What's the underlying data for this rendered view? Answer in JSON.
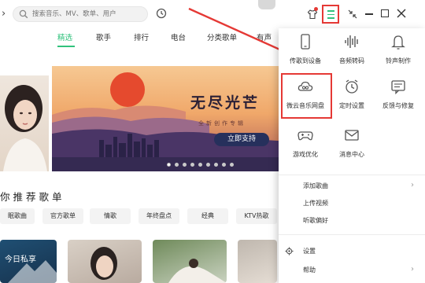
{
  "search": {
    "placeholder": "搜索音乐、MV、歌单、用户"
  },
  "nav": {
    "tabs": [
      {
        "label": "精选",
        "active": true
      },
      {
        "label": "歌手"
      },
      {
        "label": "排行"
      },
      {
        "label": "电台"
      },
      {
        "label": "分类歌单"
      },
      {
        "label": "有声"
      }
    ]
  },
  "banner": {
    "title": "无尽光芒",
    "subtitle": "全新创作专辑",
    "cta": "立即支持",
    "slides_total": 9,
    "slide_active": 1
  },
  "recommend": {
    "title": "你推荐歌单",
    "chips": [
      "眠歌曲",
      "官方歌单",
      "情歌",
      "年终盘点",
      "经典",
      "KTV热歌"
    ],
    "cards": [
      {
        "label": "今日私享"
      }
    ]
  },
  "menu_panel": {
    "grid": [
      {
        "label": "传歌到设备",
        "icon": "phone-icon"
      },
      {
        "label": "音频转码",
        "icon": "audio-wave-icon"
      },
      {
        "label": "铃声制作",
        "icon": "bell-icon"
      },
      {
        "label": "微云音乐网盘",
        "icon": "cloud-icon",
        "highlighted": true
      },
      {
        "label": "定时设置",
        "icon": "alarm-clock-icon"
      },
      {
        "label": "反馈与修复",
        "icon": "feedback-icon"
      },
      {
        "label": "游戏优化",
        "icon": "gamepad-icon"
      },
      {
        "label": "消息中心",
        "icon": "mail-icon"
      }
    ],
    "list": [
      {
        "label": "添加歌曲",
        "has_submenu": true
      },
      {
        "label": "上传视频",
        "has_submenu": false
      },
      {
        "label": "听歌偏好",
        "has_submenu": false
      },
      {
        "label": "设置",
        "has_submenu": false,
        "icon": "gear-icon"
      },
      {
        "label": "帮助",
        "has_submenu": true
      }
    ]
  },
  "colors": {
    "accent": "#31c27c",
    "annotation_red": "#e53935",
    "banner_button": "#26305c"
  }
}
